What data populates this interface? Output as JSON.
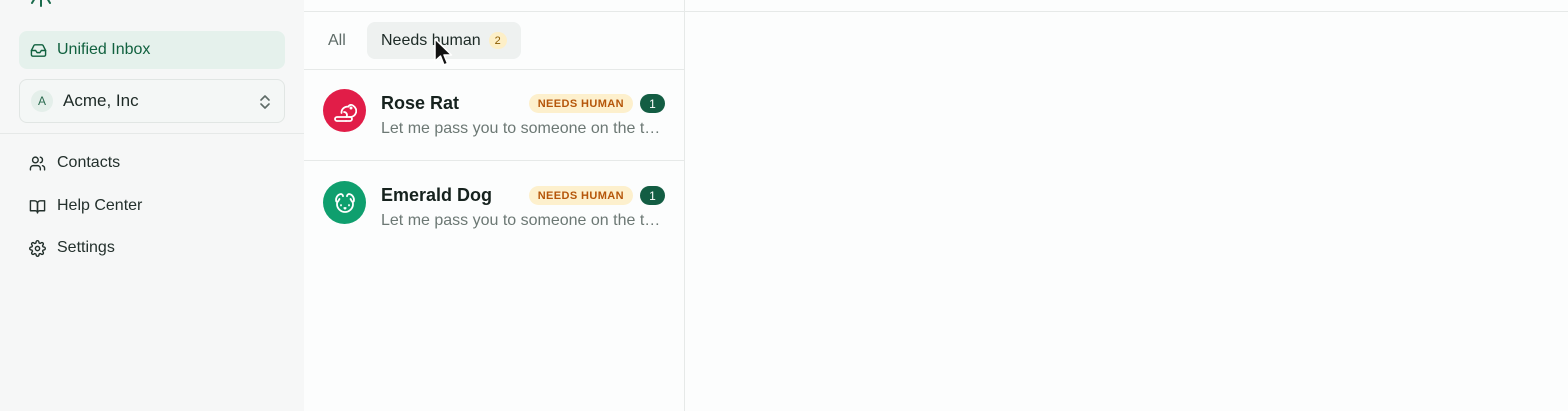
{
  "sidebar": {
    "brand_icon": "sunburst-logo-icon",
    "nav_active": {
      "label": "Unified Inbox",
      "icon": "inbox-icon"
    },
    "org": {
      "initial": "A",
      "name": "Acme, Inc",
      "icon": "chevron-up-down-icon"
    },
    "items": [
      {
        "label": "Contacts",
        "icon": "users-icon"
      },
      {
        "label": "Help Center",
        "icon": "book-icon"
      },
      {
        "label": "Settings",
        "icon": "gear-icon"
      }
    ]
  },
  "tabs": {
    "all_label": "All",
    "needs_label": "Needs human",
    "needs_count": "2"
  },
  "conversations": [
    {
      "name": "Rose Rat",
      "badge": "NEEDS HUMAN",
      "count": "1",
      "preview": "Let me pass you to someone on the team who can help.",
      "avatar_color": "#e11d48",
      "icon": "rat-icon"
    },
    {
      "name": "Emerald Dog",
      "badge": "NEEDS HUMAN",
      "count": "1",
      "preview": "Let me pass you to someone on the team who can help.",
      "avatar_color": "#0f9f6e",
      "icon": "dog-icon"
    }
  ],
  "colors": {
    "accent": "#135d43",
    "badge_bg": "#fdf0cd",
    "badge_text": "#b5560a"
  }
}
